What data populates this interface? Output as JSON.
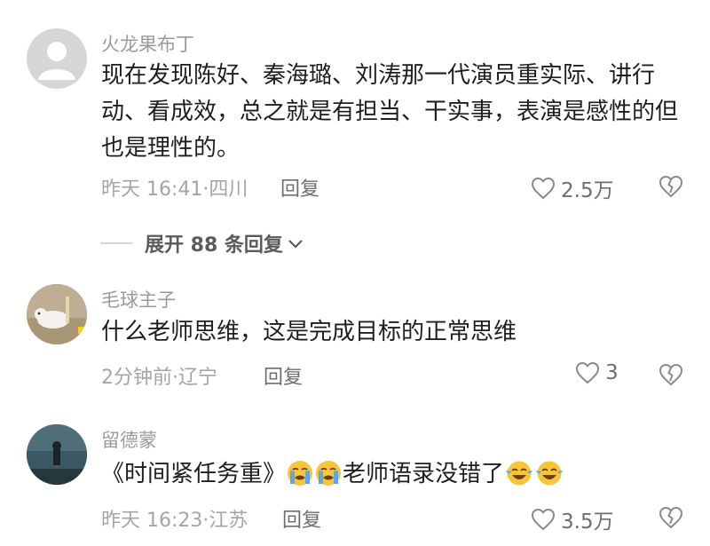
{
  "comments": [
    {
      "username": "火龙果布丁",
      "text": "现在发现陈好、秦海璐、刘涛那一代演员重实际、讲行动、看成效，总之就是有担当、干实事，表演是感性的但也是理性的。",
      "meta": "昨天 16:41·四川",
      "reply_label": "回复",
      "likes": "2.5万",
      "expand_label": "展开 88 条回复"
    },
    {
      "username": "毛球主子",
      "text": "什么老师思维，这是完成目标的正常思维",
      "meta": "2分钟前·辽宁",
      "reply_label": "回复",
      "likes": "3"
    },
    {
      "username": "留德蒙",
      "text_part1": "《时间紧任务重》",
      "text_part2": "老师语录没错了",
      "meta": "昨天 16:23·江苏",
      "reply_label": "回复",
      "likes": "3.5万"
    }
  ],
  "icons": {
    "like": "heart-outline-icon",
    "dislike": "broken-heart-icon",
    "expand": "chevron-down-icon",
    "emoji_cry": "loudly-crying-face-emoji",
    "emoji_joy": "tears-of-joy-emoji"
  }
}
